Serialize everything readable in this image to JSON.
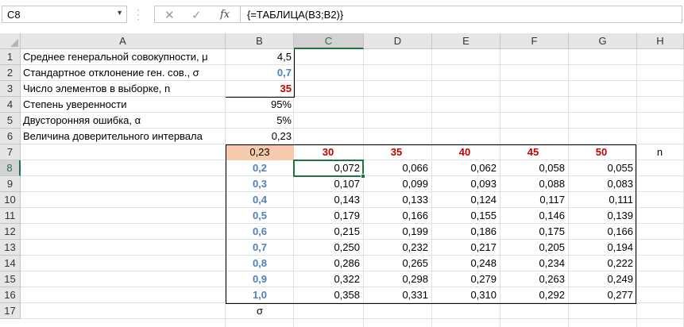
{
  "formula_bar": {
    "name_box": "C8",
    "cancel_icon": "✕",
    "enter_icon": "✓",
    "fx_label": "fx",
    "formula": "{=ТАБЛИЦА(B3;B2)}"
  },
  "columns": [
    "A",
    "B",
    "C",
    "D",
    "E",
    "F",
    "G",
    "H"
  ],
  "rows": [
    "1",
    "2",
    "3",
    "4",
    "5",
    "6",
    "7",
    "8",
    "9",
    "10",
    "11",
    "12",
    "13",
    "14",
    "15",
    "16",
    "17"
  ],
  "selection": {
    "column": "C",
    "row": "8"
  },
  "params": {
    "mean_label": "Среднее генеральной совокупности, μ",
    "mean_value": "4,5",
    "sd_label": "Стандартное отклонение ген. сов., σ",
    "sd_value": "0,7",
    "n_label": "Число элементов в выборке, n",
    "n_value": "35",
    "confidence_label": "Степень уверенности",
    "confidence_value": "95%",
    "error_label": "Двусторонняя ошибка, α",
    "error_value": "5%",
    "interval_label": "Величина доверительного интервала",
    "interval_value": "0,23"
  },
  "table": {
    "corner_value": "0,23",
    "n_headers": [
      "30",
      "35",
      "40",
      "45",
      "50"
    ],
    "n_axis_label": "n",
    "sigma_axis_label": "σ",
    "sigma_values": [
      "0,2",
      "0,3",
      "0,4",
      "0,5",
      "0,6",
      "0,7",
      "0,8",
      "0,9",
      "1,0"
    ],
    "values": [
      [
        "0,072",
        "0,066",
        "0,062",
        "0,058",
        "0,055"
      ],
      [
        "0,107",
        "0,099",
        "0,093",
        "0,088",
        "0,083"
      ],
      [
        "0,143",
        "0,133",
        "0,124",
        "0,117",
        "0,111"
      ],
      [
        "0,179",
        "0,166",
        "0,155",
        "0,146",
        "0,139"
      ],
      [
        "0,215",
        "0,199",
        "0,186",
        "0,175",
        "0,166"
      ],
      [
        "0,250",
        "0,232",
        "0,217",
        "0,205",
        "0,194"
      ],
      [
        "0,286",
        "0,265",
        "0,248",
        "0,234",
        "0,222"
      ],
      [
        "0,322",
        "0,298",
        "0,279",
        "0,263",
        "0,249"
      ],
      [
        "0,358",
        "0,331",
        "0,310",
        "0,292",
        "0,277"
      ]
    ]
  },
  "colors": {
    "selection_green": "#217346",
    "sigma_blue": "#4f81bd",
    "n_red": "#c00000",
    "corner_orange": "#f8cbad"
  }
}
